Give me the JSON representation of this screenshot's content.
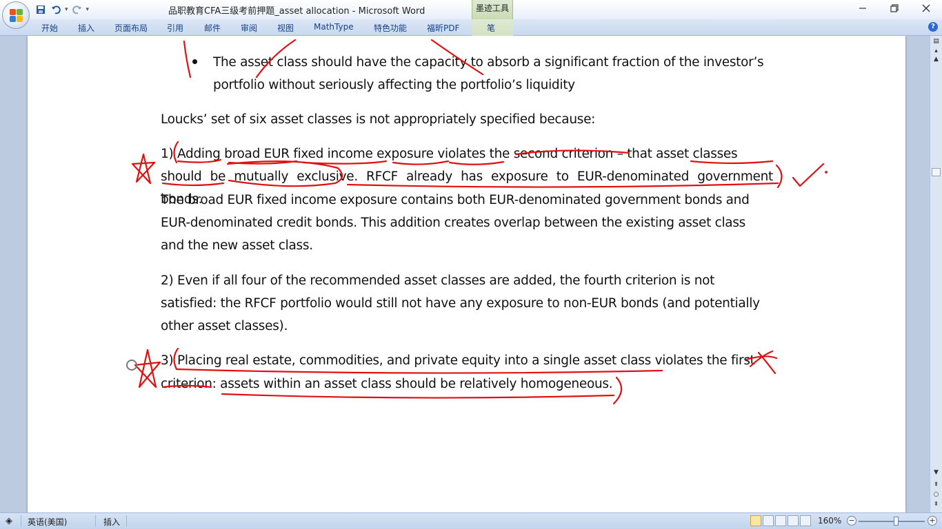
{
  "window": {
    "title": "品职教育CFA三级考前押题_asset allocation - Microsoft Word",
    "contextual_tab": "墨迹工具"
  },
  "qat": {
    "save_icon": "save-icon",
    "undo_icon": "undo-icon",
    "redo_icon": "redo-icon"
  },
  "ribbon": {
    "tabs": [
      "开始",
      "插入",
      "页面布局",
      "引用",
      "邮件",
      "审阅",
      "视图",
      "MathType",
      "特色功能",
      "福昕PDF",
      "笔"
    ]
  },
  "document": {
    "bullet_line1": "The asset class should have the capacity to absorb a significant fraction of the investor’s",
    "bullet_line2": "portfolio without seriously affecting the portfolio’s liquidity",
    "intro": "Loucks’ set of six asset classes is not appropriately specified because:",
    "p1_line1": "1) Adding broad EUR fixed income exposure violates the second criterion – that asset classes",
    "p1_line2": "should be mutually exclusive. RFCF already has exposure to EUR-denominated government bonds.",
    "p1_line3": "The broad EUR fixed income exposure contains both EUR-denominated government bonds and",
    "p1_line4": "EUR-denominated credit bonds. This addition creates overlap between the existing asset class",
    "p1_line5": "and the new asset class.",
    "p2_line1": "2) Even if all four of the recommended asset classes are added, the fourth criterion is not",
    "p2_line2": "satisfied: the RFCF portfolio would still not have any exposure to non-EUR bonds (and potentially",
    "p2_line3": "other asset classes).",
    "p3_line1": "3) Placing real estate, commodities, and private equity into a single asset class violates the first",
    "p3_line2": "criterion: assets within an asset class should be relatively homogeneous."
  },
  "statusbar": {
    "language": "英语(美国)",
    "mode": "插入",
    "zoom": "160%"
  },
  "colors": {
    "ink": "#e01010",
    "ribbon_text": "#15428b",
    "doc_background": "#bccbe0"
  }
}
